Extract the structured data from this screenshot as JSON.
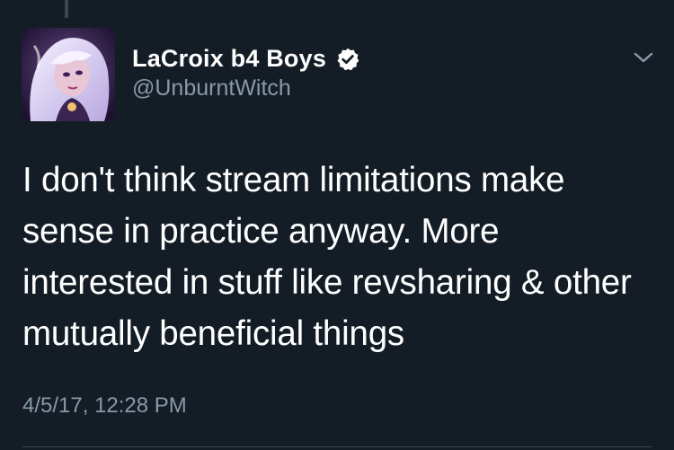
{
  "tweet": {
    "author": {
      "display_name": "LaCroix b4 Boys",
      "handle": "@UnburntWitch",
      "verified": true,
      "avatar_icon": "avatar-illustration"
    },
    "text": "I don't think stream limitations make sense in practice anyway. More interested in stuff like revsharing & other mutually beneficial things",
    "timestamp": "4/5/17, 12:28 PM"
  },
  "theme": {
    "background": "#141d26",
    "text_primary": "#ffffff",
    "text_secondary": "#8899a6",
    "verified_badge": "#ffffff",
    "divider": "#3a4652"
  },
  "icons": {
    "verified": "verified-badge-icon",
    "menu": "chevron-down-icon"
  }
}
